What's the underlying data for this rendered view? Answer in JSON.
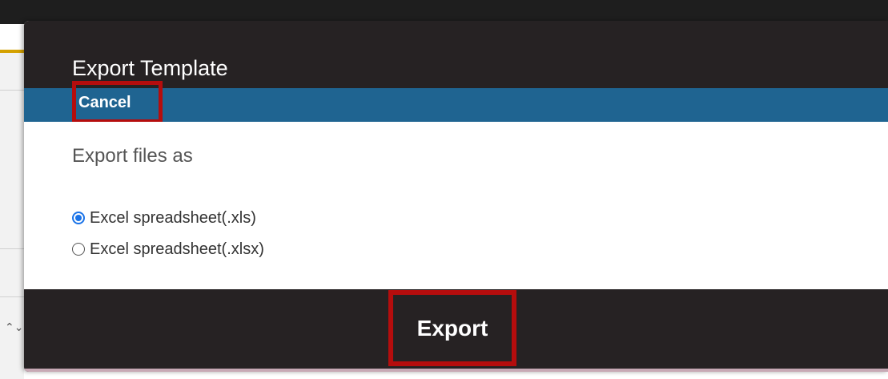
{
  "dialog": {
    "title": "Export Template",
    "cancel_label": "Cancel",
    "section_label": "Export files as",
    "options": [
      {
        "label": "Excel spreadsheet(.xls)",
        "selected": true
      },
      {
        "label": "Excel spreadsheet(.xlsx)",
        "selected": false
      }
    ],
    "export_label": "Export"
  },
  "background": {
    "stepper_icon": "⌃⌄"
  },
  "colors": {
    "header_bg": "#262223",
    "action_bar_bg": "#1f6491",
    "highlight_border": "#b50d0d",
    "radio_accent": "#1a73e8"
  }
}
